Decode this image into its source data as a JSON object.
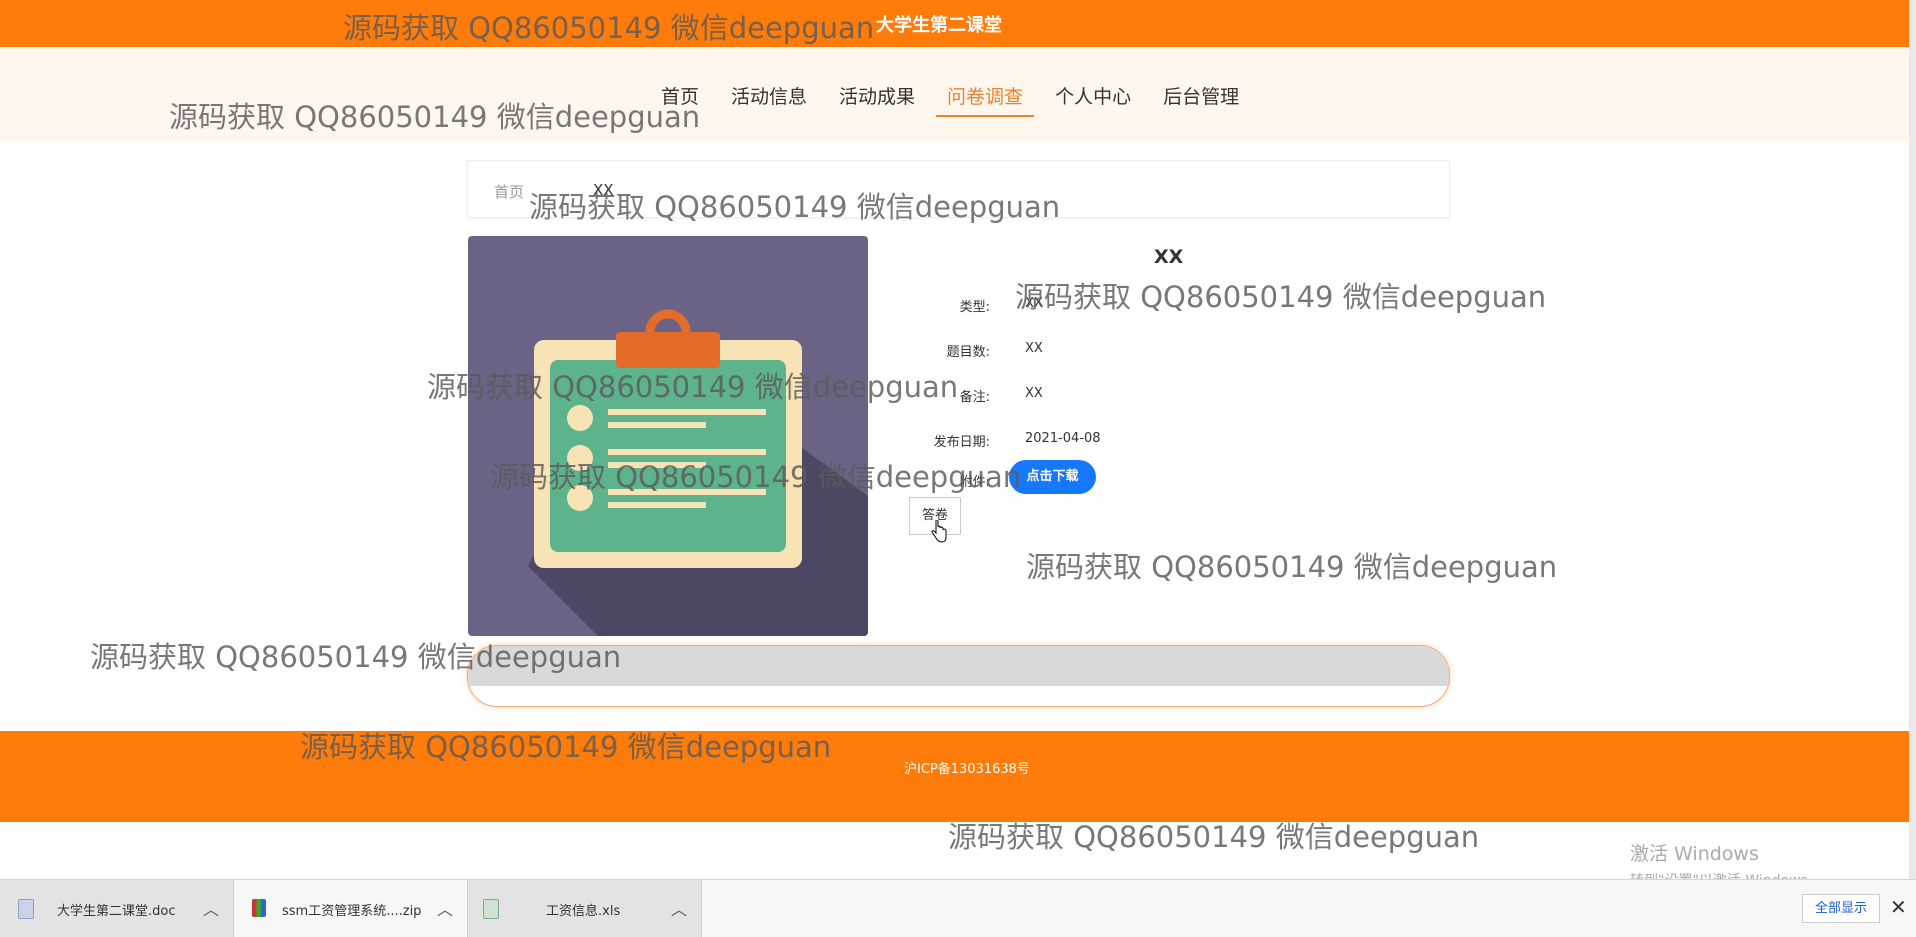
{
  "header": {
    "site_title": "大学生第二课堂"
  },
  "nav": {
    "items": [
      "首页",
      "活动信息",
      "活动成果",
      "问卷调查",
      "个人中心",
      "后台管理"
    ],
    "active": "问卷调查"
  },
  "breadcrumb": {
    "home": "首页",
    "current": "XX"
  },
  "detail": {
    "title": "XX",
    "fields": [
      {
        "label": "类型:",
        "value": "XX"
      },
      {
        "label": "题目数:",
        "value": "XX"
      },
      {
        "label": "备注:",
        "value": "XX"
      },
      {
        "label": "发布日期:",
        "value": "2021-04-08"
      }
    ],
    "attachment_label": "附件:",
    "download_label": "点击下载",
    "answer_label": "答卷"
  },
  "footer": {
    "icp": "沪ICP备13031638号"
  },
  "watermark_text": "源码获取 QQ86050149 微信deepguan",
  "windows_activation": {
    "line1": "激活 Windows",
    "line2": "转到\"设置\"以激活 Windows。"
  },
  "downloads": {
    "items": [
      {
        "name": "大学生第二课堂.doc",
        "icon": "word-file-icon"
      },
      {
        "name": "ssm工资管理系统....zip",
        "icon": "zip-archive-icon"
      },
      {
        "name": "工资信息.xls",
        "icon": "excel-file-icon"
      }
    ],
    "show_all": "全部显示",
    "close": "✕"
  },
  "colors": {
    "brand_orange": "#ff7b0a",
    "nav_active": "#e9812d",
    "download_blue": "#1677ff",
    "image_bg": "#6a6386"
  }
}
